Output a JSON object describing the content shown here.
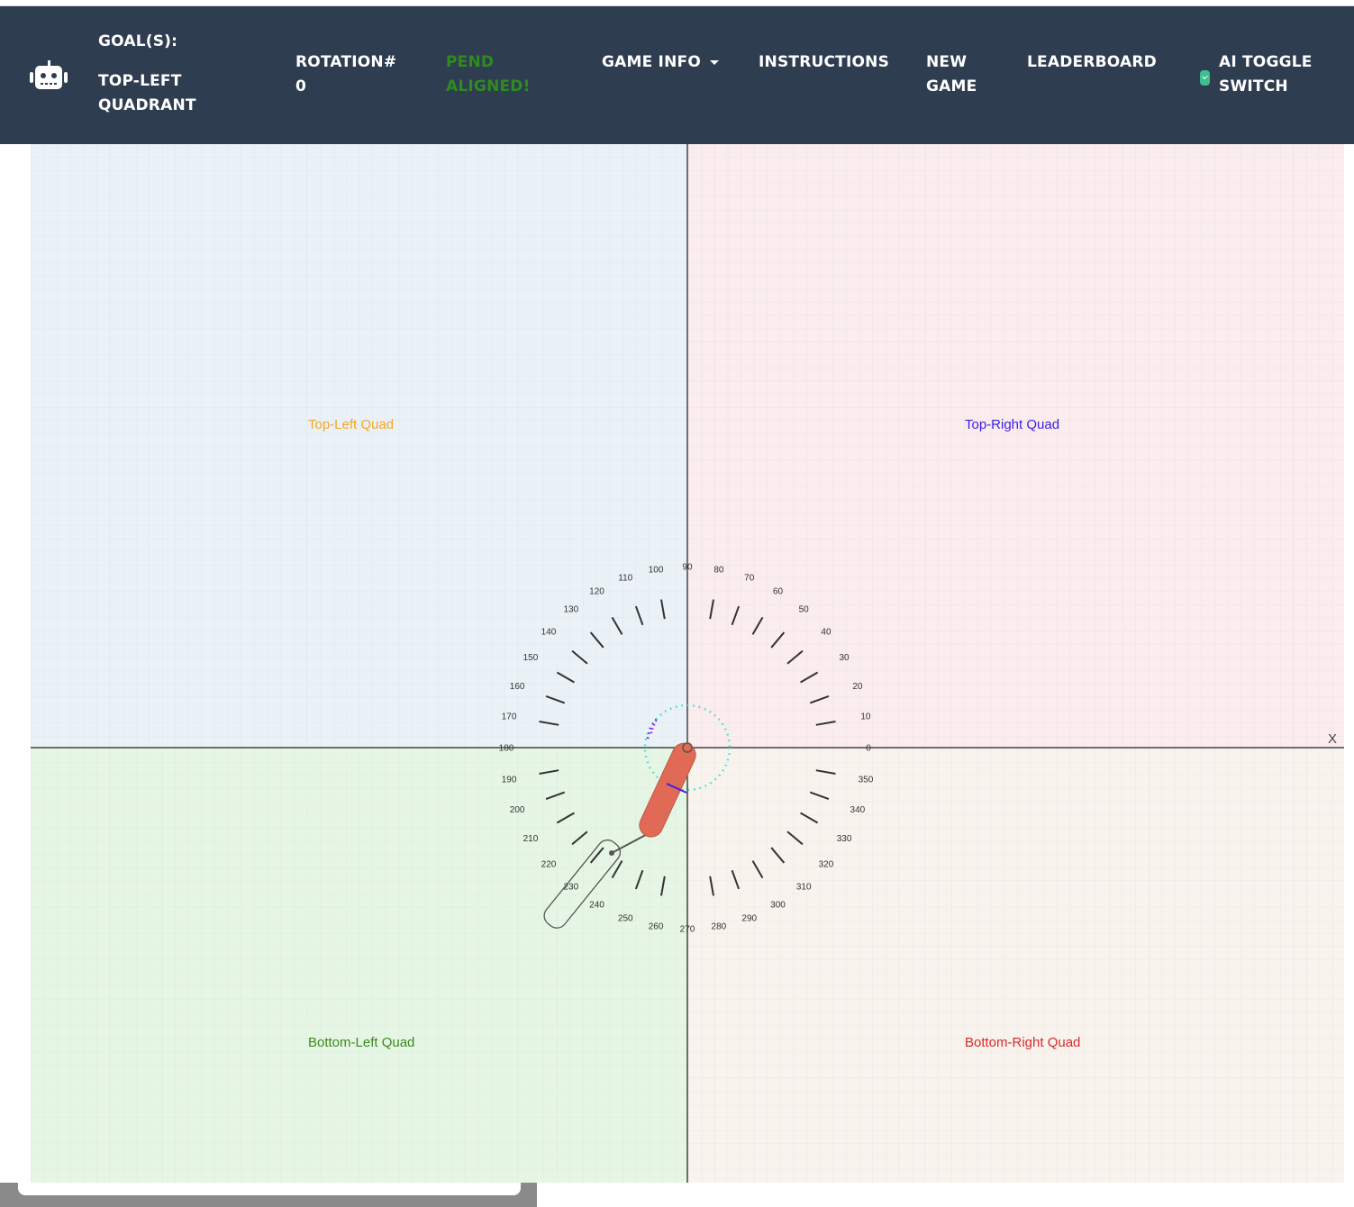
{
  "navbar": {
    "goal_title": "GOAL(S):",
    "goal_line1": "TOP-LEFT",
    "goal_line2": "QUADRANT",
    "rotation_label": "ROTATION#",
    "rotation_value": "0",
    "status_line1": "PEND",
    "status_line2": "ALIGNED!",
    "status_color": "#2e8b1e",
    "game_info": "GAME INFO",
    "instructions": "INSTRUCTIONS",
    "new_game_line1": "NEW",
    "new_game_line2": "GAME",
    "leaderboard": "LEADERBOARD",
    "ai_toggle_line1": "AI TOGGLE",
    "ai_toggle_line2": "SWITCH",
    "ai_toggle_on": true,
    "bg_color": "#2f3d51"
  },
  "board": {
    "x_axis_label": "X",
    "quadrants": [
      {
        "label": "Top-Left Quad",
        "color": "#f5a623",
        "bg": "#eaf2f7"
      },
      {
        "label": "Top-Right Quad",
        "color": "#3a1ee8",
        "bg": "#fbecee"
      },
      {
        "label": "Bottom-Left Quad",
        "color": "#3a8a1e",
        "bg": "#e6f6e4"
      },
      {
        "label": "Bottom-Right Quad",
        "color": "#d82a2a",
        "bg": "#f9f3ee"
      }
    ],
    "dial_labels": [
      "0",
      "10",
      "20",
      "30",
      "40",
      "50",
      "60",
      "70",
      "80",
      "90",
      "100",
      "110",
      "120",
      "130",
      "140",
      "150",
      "160",
      "170",
      "180",
      "190",
      "200",
      "210",
      "220",
      "230",
      "240",
      "250",
      "260",
      "270",
      "280",
      "290",
      "300",
      "310",
      "320",
      "330",
      "340",
      "350"
    ],
    "pendulum": {
      "body_color": "#e06a55",
      "angle_deg": 245
    }
  }
}
